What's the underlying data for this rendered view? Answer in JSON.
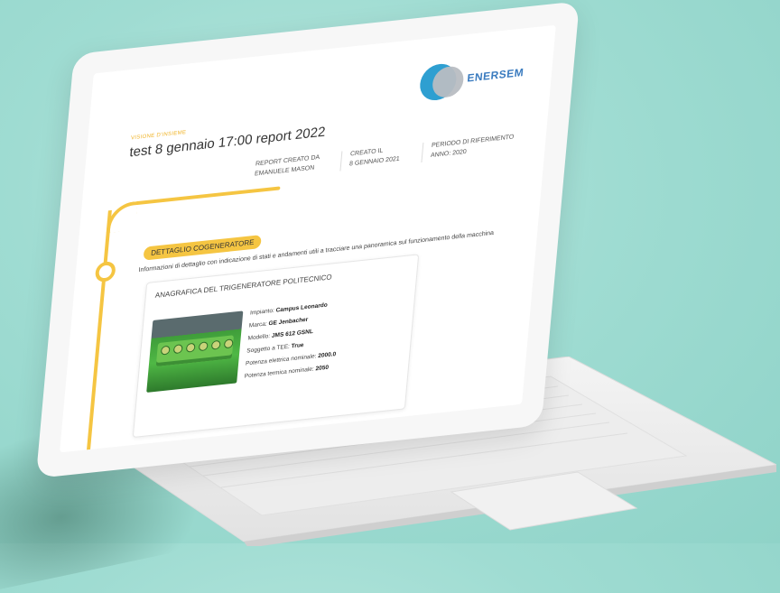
{
  "report": {
    "tag": "VISIONE D'INSIEME",
    "title": "test 8 gennaio 17:00 report 2022",
    "logo_text": "ENERSEM",
    "meta": {
      "created_by_label": "REPORT CREATO DA",
      "created_by_value": "EMANUELE MASON",
      "created_on_label": "CREATO IL",
      "created_on_value": "8 GENNAIO 2021",
      "period_label": "PERIODO DI RIFERIMENTO",
      "period_value": "ANNO: 2020"
    },
    "section": {
      "label": "DETTAGLIO COGENERATORE",
      "description": "Informazioni di dettaglio con indicazione di stati e andamenti utili a tracciare una panoramica sul funzionamento della macchina"
    },
    "card": {
      "title": "ANAGRAFICA DEL TRIGENERATORE POLITECNICO",
      "specs": [
        {
          "label": "Impianto:",
          "value": "Campus Leonardo"
        },
        {
          "label": "Marca:",
          "value": "GE Jenbacher"
        },
        {
          "label": "Modello:",
          "value": "JMS 612 GSNL"
        },
        {
          "label": "Soggetto a TEE:",
          "value": "True"
        },
        {
          "label": "Potenza elettrica nominale:",
          "value": "2000.0"
        },
        {
          "label": "Potenza termica nominale:",
          "value": "2050"
        }
      ]
    }
  },
  "colors": {
    "accent": "#f5c542",
    "logo_blue": "#2e9fd1",
    "logo_grey": "#b8bdc2",
    "background": "#9fdcd2"
  }
}
